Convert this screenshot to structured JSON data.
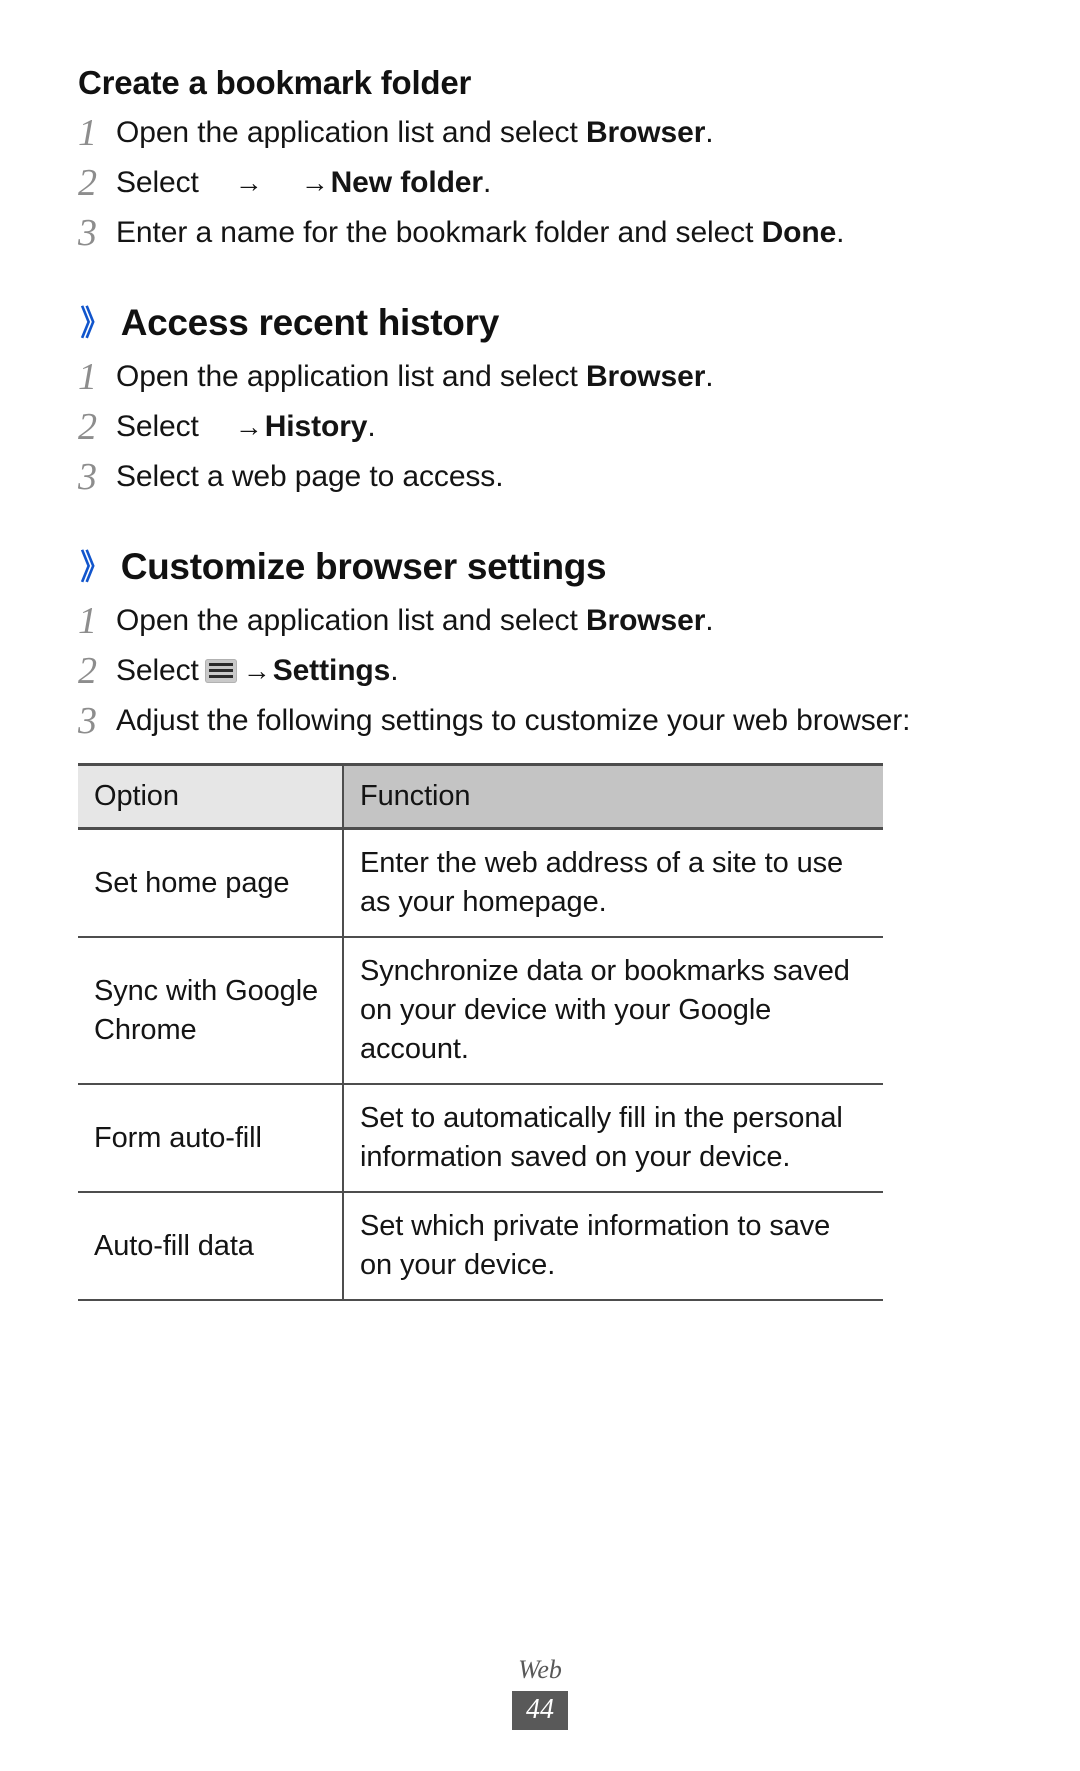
{
  "document": {
    "sub_heading": "Create a bookmark folder",
    "sections": [
      {
        "heading": "Access recent history",
        "chevron": "》"
      },
      {
        "heading": "Customize browser settings",
        "chevron": "》"
      }
    ]
  },
  "bookmark_folder": {
    "step1_num": "1",
    "step1_a": "Open the application list and select ",
    "step1_b": "Browser",
    "step1_c": ".",
    "step2_num": "2",
    "step2_a": "Select",
    "step2_arrow1": "→",
    "step2_arrow2": "→",
    "step2_b": "New folder",
    "step2_c": ".",
    "step3_num": "3",
    "step3_a": "Enter a name for the bookmark folder and select ",
    "step3_b": "Done",
    "step3_c": "."
  },
  "recent_history": {
    "step1_num": "1",
    "step1_a": "Open the application list and select ",
    "step1_b": "Browser",
    "step1_c": ".",
    "step2_num": "2",
    "step2_a": "Select",
    "step2_arrow": "→",
    "step2_b": "History",
    "step2_c": ".",
    "step3_num": "3",
    "step3_a": "Select a web page to access."
  },
  "browser_settings": {
    "step1_num": "1",
    "step1_a": "Open the application list and select ",
    "step1_b": "Browser",
    "step1_c": ".",
    "step2_num": "2",
    "step2_a": "Select",
    "step2_icon": "menu-icon",
    "step2_arrow": "→",
    "step2_b": "Settings",
    "step2_c": ".",
    "step3_num": "3",
    "step3_a": "Adjust the following settings to customize your web browser:"
  },
  "settings_table": {
    "headers": [
      "Option",
      "Function"
    ],
    "rows": [
      {
        "option": "Set home page",
        "function": "Enter the web address of a site to use as your homepage."
      },
      {
        "option": "Sync with Google Chrome",
        "function": "Synchronize data or bookmarks saved on your device with your Google account."
      },
      {
        "option": "Form auto-fill",
        "function": "Set to automatically fill in the personal information saved on your device."
      },
      {
        "option": "Auto-fill data",
        "function": "Set which private information to save on your device."
      }
    ]
  },
  "footer": {
    "section_label": "Web",
    "page_number": "44"
  },
  "colors": {
    "heading_chevron": "#1155cc",
    "step_number": "#8d8d8d",
    "table_header_option_bg": "#e6e6e6",
    "table_header_function_bg": "#c4c4c4",
    "table_border": "#4d4d4d",
    "footer_badge_bg": "#595959"
  }
}
